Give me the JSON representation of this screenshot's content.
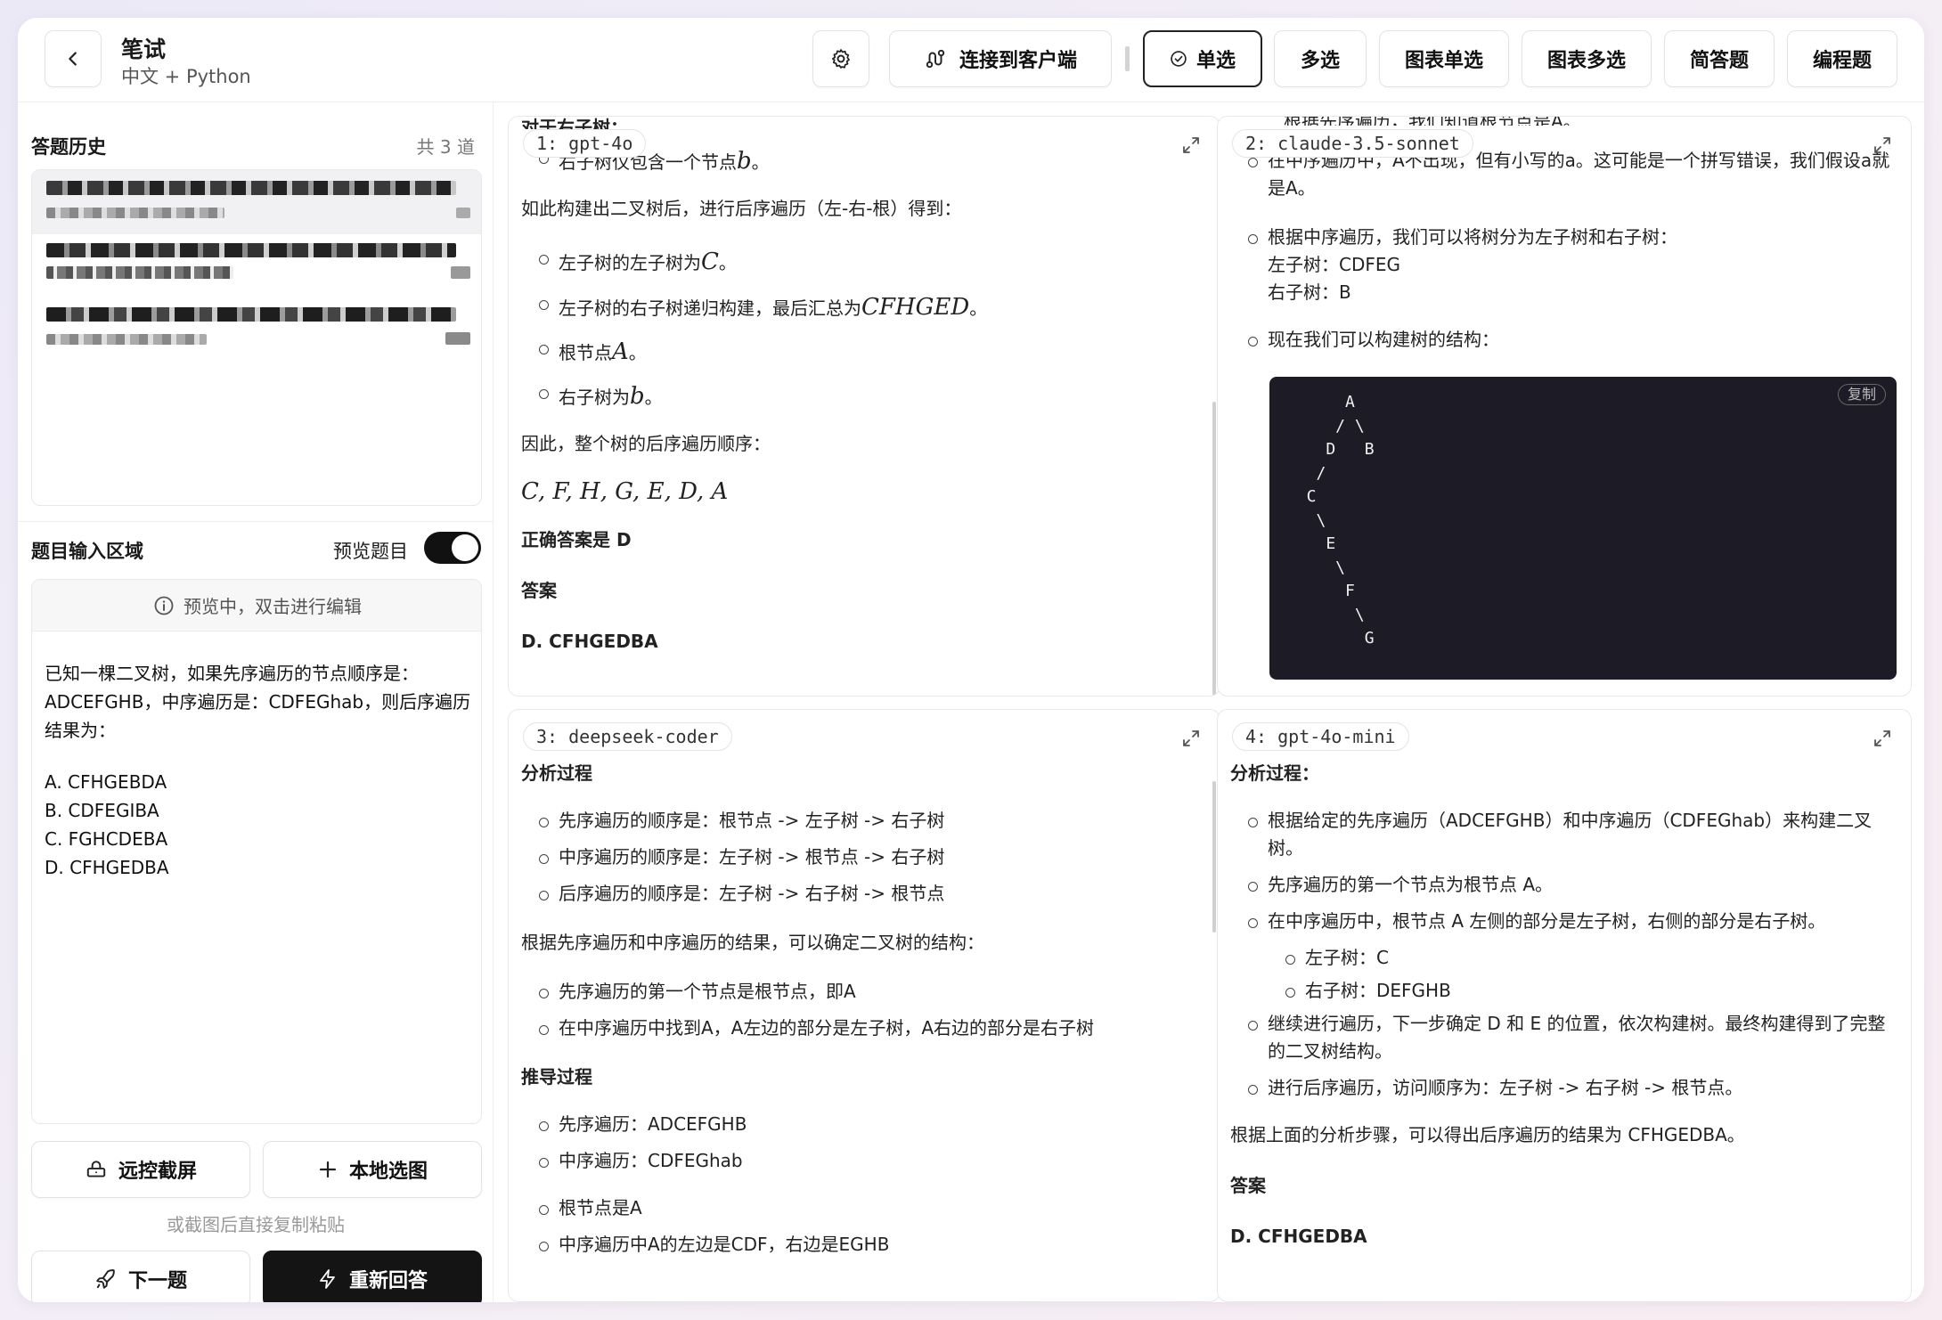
{
  "header": {
    "title": "笔试",
    "subtitle": "中文 + Python",
    "connect_label": "连接到客户端",
    "tabs": [
      {
        "label": "单选",
        "active": true
      },
      {
        "label": "多选"
      },
      {
        "label": "图表单选"
      },
      {
        "label": "图表多选"
      },
      {
        "label": "简答题"
      },
      {
        "label": "编程题"
      }
    ]
  },
  "history": {
    "title": "答题历史",
    "count": "共 3 道"
  },
  "input_area": {
    "title": "题目输入区域",
    "preview_label": "预览题目",
    "preview_on": true,
    "hint": "预览中，双击进行编辑",
    "question": [
      "已知一棵二叉树，如果先序遍历的节点顺序是：ADCEFGHB，中序遍历是：CDFEGhab，则后序遍历结果为："
    ],
    "options": [
      "A. CFHGEBDA",
      "B. CDFEGIBA",
      "C. FGHCDEBA",
      "D. CFHGEDBA"
    ]
  },
  "actions": {
    "remote_capture": "远控截屏",
    "local_select": "本地选图",
    "paste_hint": "或截图后直接复制粘贴",
    "next": "下一题",
    "reanswer": "重新回答"
  },
  "panels": [
    {
      "tag": "1: gpt-4o",
      "cut_top": "对于右子树：",
      "item1": "右子树仅包含一个节点",
      "item1_math": "b",
      "p1": "如此构建出二叉树后，进行后序遍历（左-右-根）得到：",
      "list": [
        {
          "text": "左子树的左子树为",
          "math": "C"
        },
        {
          "text": "左子树的右子树递归构建，最后汇总为",
          "math": "CFHGED"
        },
        {
          "text": "根节点",
          "math": "A"
        },
        {
          "text": "右子树为",
          "math": "b"
        }
      ],
      "p2": "因此，整个树的后序遍历顺序：",
      "sequence": "C, F, H, G, E, D, A",
      "correct": "正确答案是 D",
      "answer_heading": "答案",
      "answer": "D. CFHGEDBA"
    },
    {
      "tag": "2: claude-3.5-sonnet",
      "cut_top": "根据先序遍历，我们知道根节点是A。",
      "item1": "在中序遍历中，A不出现，但有小写的a。这可能是一个拼写错误，我们假设a就是A。",
      "item2": "根据中序遍历，我们可以将树分为左子树和右子树：",
      "item2_l1": "左子树：CDFEG",
      "item2_l2": "右子树：B",
      "item3": "现在我们可以构建树的结构：",
      "copy": "复制",
      "code": "      A\n     / \\\n    D   B\n   /\n  C\n   \\\n    E\n     \\\n      F\n       \\\n        G"
    },
    {
      "tag": "3: deepseek-coder",
      "h1": "分析过程",
      "list1": [
        "先序遍历的顺序是：根节点 -> 左子树 -> 右子树",
        "中序遍历的顺序是：左子树 -> 根节点 -> 右子树",
        "后序遍历的顺序是：左子树 -> 右子树 -> 根节点"
      ],
      "p1": "根据先序遍历和中序遍历的结果，可以确定二叉树的结构：",
      "list2": [
        "先序遍历的第一个节点是根节点，即A",
        "在中序遍历中找到A，A左边的部分是左子树，A右边的部分是右子树"
      ],
      "h2": "推导过程",
      "list3": [
        "先序遍历：ADCEFGHB",
        "中序遍历：CDFEGhab"
      ],
      "list4": [
        "根节点是A",
        "中序遍历中A的左边是CDF，右边是EGHB"
      ]
    },
    {
      "tag": "4: gpt-4o-mini",
      "h1": "分析过程：",
      "list": [
        "根据给定的先序遍历（ADCEFGHB）和中序遍历（CDFEGhab）来构建二叉树。",
        "先序遍历的第一个节点为根节点 A。",
        "在中序遍历中，根节点 A 左侧的部分是左子树，右侧的部分是右子树。"
      ],
      "sub": [
        "左子树：C",
        "右子树：DEFGHB"
      ],
      "list_b": [
        "继续进行遍历，下一步确定 D 和 E 的位置，依次构建树。最终构建得到了完整的二叉树结构。",
        "进行后序遍历，访问顺序为：左子树 -> 右子树 -> 根节点。"
      ],
      "p1": "根据上面的分析步骤，可以得出后序遍历的结果为 CFHGEDBA。",
      "answer_heading": "答案",
      "answer": "D. CFHGEDBA"
    }
  ]
}
